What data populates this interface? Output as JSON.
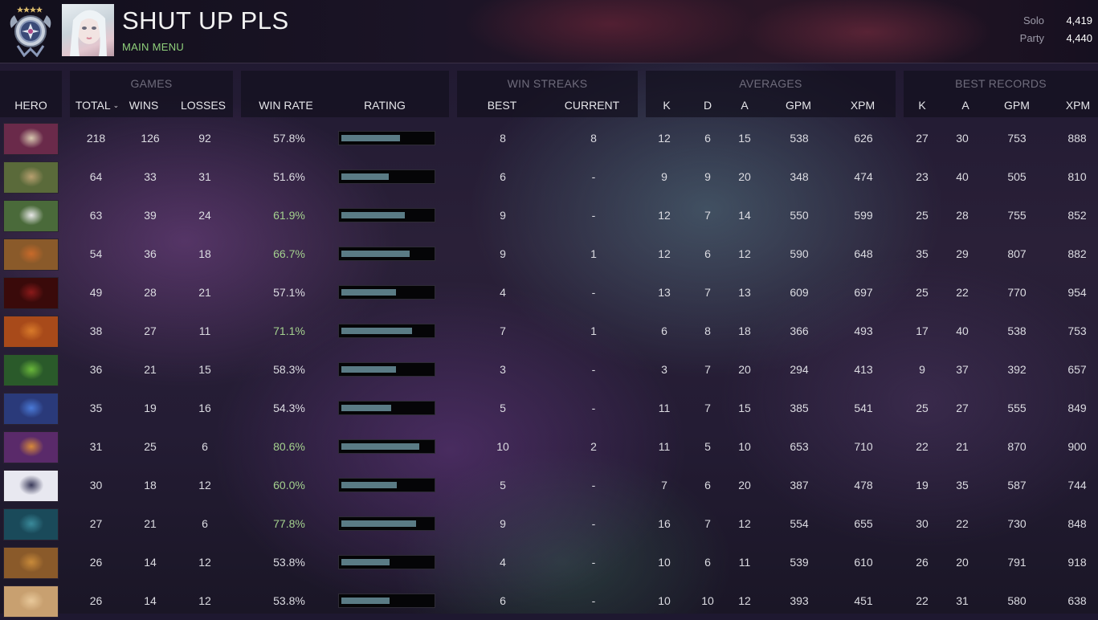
{
  "header": {
    "player_name": "SHUT UP PLS",
    "nav_link": "MAIN MENU",
    "mmr": [
      {
        "label": "Solo",
        "value": "4,419"
      },
      {
        "label": "Party",
        "value": "4,440"
      }
    ]
  },
  "table": {
    "groups": {
      "games": "GAMES",
      "win_streaks": "WIN STREAKS",
      "averages": "AVERAGES",
      "best_records": "BEST RECORDS"
    },
    "columns": {
      "hero": "HERO",
      "total": "TOTAL",
      "wins": "WINS",
      "losses": "LOSSES",
      "win_rate": "WIN RATE",
      "rating": "RATING",
      "best": "BEST",
      "current": "CURRENT",
      "avg_k": "K",
      "avg_d": "D",
      "avg_a": "A",
      "avg_gpm": "GPM",
      "avg_xpm": "XPM",
      "best_k": "K",
      "best_a": "A",
      "best_gpm": "GPM",
      "best_xpm": "XPM"
    },
    "rows": [
      {
        "total": "218",
        "wins": "126",
        "losses": "92",
        "win_rate": "57.8%",
        "highlight": false,
        "rating": 0.65,
        "best": "8",
        "current": "8",
        "k": "12",
        "d": "6",
        "a": "15",
        "gpm": "538",
        "xpm": "626",
        "bk": "27",
        "ba": "30",
        "bgpm": "753",
        "bxpm": "888",
        "hero_colors": [
          "#3a1a2a",
          "#d8c8b0",
          "#6a2a4a"
        ]
      },
      {
        "total": "64",
        "wins": "33",
        "losses": "31",
        "win_rate": "51.6%",
        "highlight": false,
        "rating": 0.52,
        "best": "6",
        "current": "-",
        "k": "9",
        "d": "9",
        "a": "20",
        "gpm": "348",
        "xpm": "474",
        "bk": "23",
        "ba": "40",
        "bgpm": "505",
        "bxpm": "810",
        "hero_colors": [
          "#3a4a2a",
          "#b8a070",
          "#5a6a3a"
        ]
      },
      {
        "total": "63",
        "wins": "39",
        "losses": "24",
        "win_rate": "61.9%",
        "highlight": true,
        "rating": 0.7,
        "best": "9",
        "current": "-",
        "k": "12",
        "d": "7",
        "a": "14",
        "gpm": "550",
        "xpm": "599",
        "bk": "25",
        "ba": "28",
        "bgpm": "755",
        "bxpm": "852",
        "hero_colors": [
          "#2a4a5a",
          "#e8e8e8",
          "#4a6a3a"
        ]
      },
      {
        "total": "54",
        "wins": "36",
        "losses": "18",
        "win_rate": "66.7%",
        "highlight": true,
        "rating": 0.75,
        "best": "9",
        "current": "1",
        "k": "12",
        "d": "6",
        "a": "12",
        "gpm": "590",
        "xpm": "648",
        "bk": "35",
        "ba": "29",
        "bgpm": "807",
        "bxpm": "882",
        "hero_colors": [
          "#d8c8a0",
          "#c86a2a",
          "#8a5a2a"
        ]
      },
      {
        "total": "49",
        "wins": "28",
        "losses": "21",
        "win_rate": "57.1%",
        "highlight": false,
        "rating": 0.6,
        "best": "4",
        "current": "-",
        "k": "13",
        "d": "7",
        "a": "13",
        "gpm": "609",
        "xpm": "697",
        "bk": "25",
        "ba": "22",
        "bgpm": "770",
        "bxpm": "954",
        "hero_colors": [
          "#1a0a0a",
          "#8a1a1a",
          "#3a0a0a"
        ]
      },
      {
        "total": "38",
        "wins": "27",
        "losses": "11",
        "win_rate": "71.1%",
        "highlight": true,
        "rating": 0.78,
        "best": "7",
        "current": "1",
        "k": "6",
        "d": "8",
        "a": "18",
        "gpm": "366",
        "xpm": "493",
        "bk": "17",
        "ba": "40",
        "bgpm": "538",
        "bxpm": "753",
        "hero_colors": [
          "#5a2a0a",
          "#d87a2a",
          "#a84a1a"
        ]
      },
      {
        "total": "36",
        "wins": "21",
        "losses": "15",
        "win_rate": "58.3%",
        "highlight": false,
        "rating": 0.6,
        "best": "3",
        "current": "-",
        "k": "3",
        "d": "7",
        "a": "20",
        "gpm": "294",
        "xpm": "413",
        "bk": "9",
        "ba": "37",
        "bgpm": "392",
        "bxpm": "657",
        "hero_colors": [
          "#1a3a1a",
          "#6ab83a",
          "#2a5a2a"
        ]
      },
      {
        "total": "35",
        "wins": "19",
        "losses": "16",
        "win_rate": "54.3%",
        "highlight": false,
        "rating": 0.55,
        "best": "5",
        "current": "-",
        "k": "11",
        "d": "7",
        "a": "15",
        "gpm": "385",
        "xpm": "541",
        "bk": "25",
        "ba": "27",
        "bgpm": "555",
        "bxpm": "849",
        "hero_colors": [
          "#1a2a5a",
          "#4a7ad8",
          "#2a3a7a"
        ]
      },
      {
        "total": "31",
        "wins": "25",
        "losses": "6",
        "win_rate": "80.6%",
        "highlight": true,
        "rating": 0.86,
        "best": "10",
        "current": "2",
        "k": "11",
        "d": "5",
        "a": "10",
        "gpm": "653",
        "xpm": "710",
        "bk": "22",
        "ba": "21",
        "bgpm": "870",
        "bxpm": "900",
        "hero_colors": [
          "#3a1a4a",
          "#d88a3a",
          "#5a2a6a"
        ]
      },
      {
        "total": "30",
        "wins": "18",
        "losses": "12",
        "win_rate": "60.0%",
        "highlight": true,
        "rating": 0.61,
        "best": "5",
        "current": "-",
        "k": "7",
        "d": "6",
        "a": "20",
        "gpm": "387",
        "xpm": "478",
        "bk": "19",
        "ba": "35",
        "bgpm": "587",
        "bxpm": "744",
        "hero_colors": [
          "#c8d8e8",
          "#3a3a5a",
          "#e8e8f0"
        ]
      },
      {
        "total": "27",
        "wins": "21",
        "losses": "6",
        "win_rate": "77.8%",
        "highlight": true,
        "rating": 0.82,
        "best": "9",
        "current": "-",
        "k": "16",
        "d": "7",
        "a": "12",
        "gpm": "554",
        "xpm": "655",
        "bk": "30",
        "ba": "22",
        "bgpm": "730",
        "bxpm": "848",
        "hero_colors": [
          "#0a2a3a",
          "#3a8a9a",
          "#1a4a5a"
        ]
      },
      {
        "total": "26",
        "wins": "14",
        "losses": "12",
        "win_rate": "53.8%",
        "highlight": false,
        "rating": 0.53,
        "best": "4",
        "current": "-",
        "k": "10",
        "d": "6",
        "a": "11",
        "gpm": "539",
        "xpm": "610",
        "bk": "26",
        "ba": "20",
        "bgpm": "791",
        "bxpm": "918",
        "hero_colors": [
          "#5a3a1a",
          "#c88a3a",
          "#8a5a2a"
        ]
      },
      {
        "total": "26",
        "wins": "14",
        "losses": "12",
        "win_rate": "53.8%",
        "highlight": false,
        "rating": 0.53,
        "best": "6",
        "current": "-",
        "k": "10",
        "d": "10",
        "a": "12",
        "gpm": "393",
        "xpm": "451",
        "bk": "22",
        "ba": "31",
        "bgpm": "580",
        "bxpm": "638",
        "hero_colors": [
          "#8a6a3a",
          "#e8c89a",
          "#c8a070"
        ]
      }
    ]
  },
  "colors": {
    "accent_green": "#8fd07b",
    "win_rate_high": "#a4d18e",
    "rating_bar": "#5a7b85"
  }
}
